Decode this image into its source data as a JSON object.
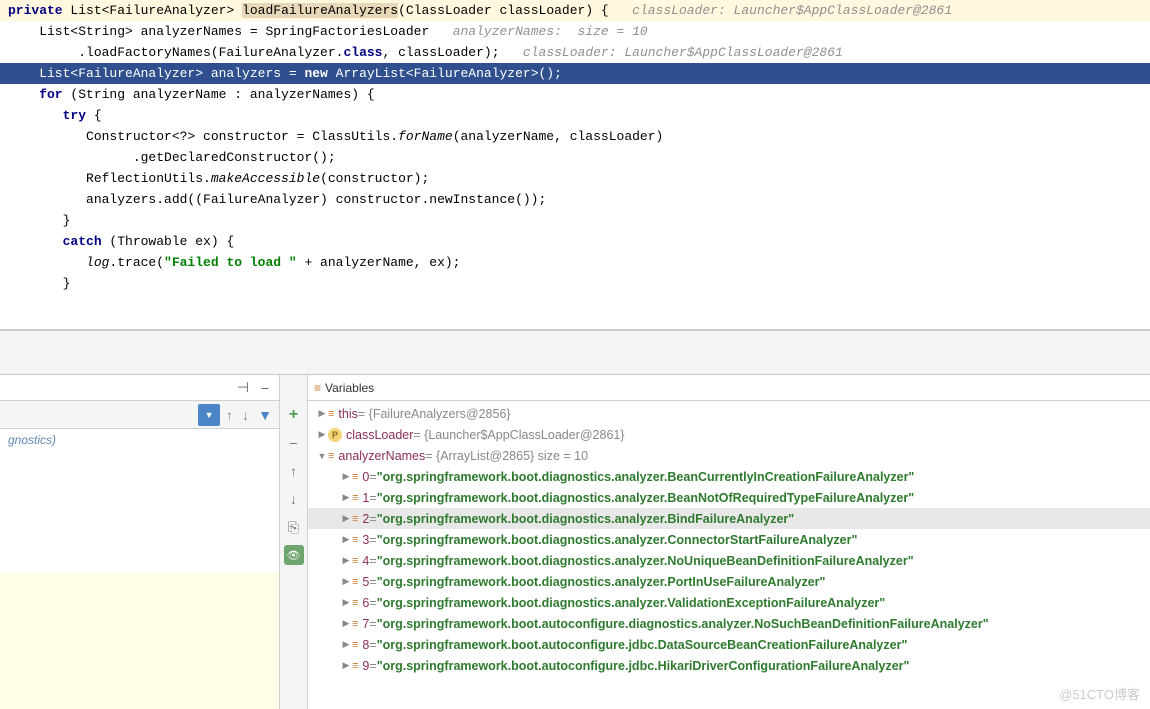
{
  "code": {
    "l1a": "private ",
    "l1b": "List<FailureAnalyzer> ",
    "l1c": "loadFailureAnalyzers",
    "l1d": "(ClassLoader classLoader) {   ",
    "l1hint": "classLoader: Launcher$AppClassLoader@2861",
    "l2a": "    List<String> analyzerNames = SpringFactoriesLoader   ",
    "l2hint": "analyzerNames:  size = 10",
    "l3a": "         .loadFactoryNames(FailureAnalyzer.",
    "l3b": "class",
    "l3c": ", classLoader);   ",
    "l3hint": "classLoader: Launcher$AppClassLoader@2861",
    "l4a": "    List<FailureAnalyzer> analyzers = ",
    "l4b": "new ",
    "l4c": "ArrayList<FailureAnalyzer>();",
    "l5a": "    for ",
    "l5b": "(String analyzerName : analyzerNames) {",
    "l6a": "       try ",
    "l6b": "{",
    "l7": "          Constructor<?> constructor = ClassUtils.",
    "l7b": "forName",
    "l7c": "(analyzerName, classLoader)",
    "l8": "                .getDeclaredConstructor();",
    "l9a": "          ReflectionUtils.",
    "l9b": "makeAccessible",
    "l9c": "(constructor);",
    "l10": "          analyzers.add((FailureAnalyzer) constructor.newInstance());",
    "l11": "       }",
    "l12a": "       catch ",
    "l12b": "(Throwable ex) {",
    "l13a": "          log",
    "l13b": ".trace(",
    "l13c": "\"Failed to load \"",
    "l13d": " + analyzerName, ex);",
    "l14": "       }"
  },
  "left": {
    "frame": "gnostics)"
  },
  "vars": {
    "title": "Variables",
    "this_name": "this",
    "this_val": " = {FailureAnalyzers@2856}",
    "cl_name": "classLoader",
    "cl_val": " = {Launcher$AppClassLoader@2861}",
    "an_name": "analyzerNames",
    "an_val": " = {ArrayList@2865}  size = 10",
    "items": [
      {
        "idx": "0",
        "val": "\"org.springframework.boot.diagnostics.analyzer.BeanCurrentlyInCreationFailureAnalyzer\""
      },
      {
        "idx": "1",
        "val": "\"org.springframework.boot.diagnostics.analyzer.BeanNotOfRequiredTypeFailureAnalyzer\""
      },
      {
        "idx": "2",
        "val": "\"org.springframework.boot.diagnostics.analyzer.BindFailureAnalyzer\""
      },
      {
        "idx": "3",
        "val": "\"org.springframework.boot.diagnostics.analyzer.ConnectorStartFailureAnalyzer\""
      },
      {
        "idx": "4",
        "val": "\"org.springframework.boot.diagnostics.analyzer.NoUniqueBeanDefinitionFailureAnalyzer\""
      },
      {
        "idx": "5",
        "val": "\"org.springframework.boot.diagnostics.analyzer.PortInUseFailureAnalyzer\""
      },
      {
        "idx": "6",
        "val": "\"org.springframework.boot.diagnostics.analyzer.ValidationExceptionFailureAnalyzer\""
      },
      {
        "idx": "7",
        "val": "\"org.springframework.boot.autoconfigure.diagnostics.analyzer.NoSuchBeanDefinitionFailureAnalyzer\""
      },
      {
        "idx": "8",
        "val": "\"org.springframework.boot.autoconfigure.jdbc.DataSourceBeanCreationFailureAnalyzer\""
      },
      {
        "idx": "9",
        "val": "\"org.springframework.boot.autoconfigure.jdbc.HikariDriverConfigurationFailureAnalyzer\""
      }
    ]
  },
  "watermark": "@51CTO博客"
}
